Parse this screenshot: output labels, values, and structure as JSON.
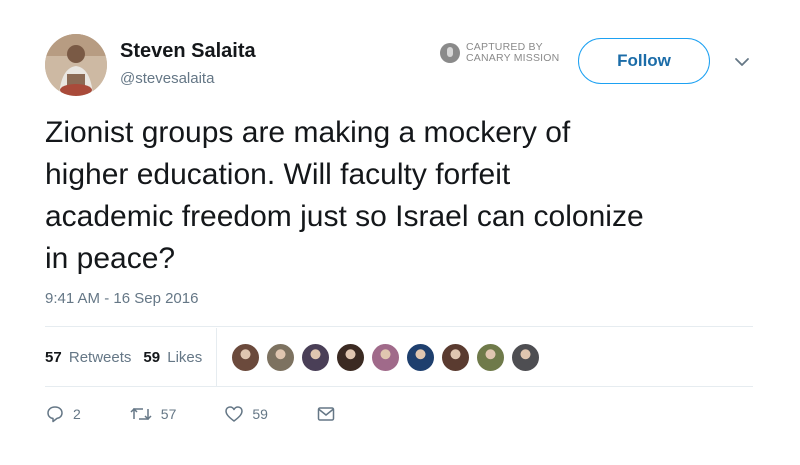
{
  "tweet": {
    "author": {
      "name": "Steven Salaita",
      "handle": "@stevesalaita"
    },
    "watermark": {
      "line1": "CAPTURED BY",
      "line2": "CANARY MISSION"
    },
    "follow_label": "Follow",
    "text": "Zionist groups are making a mockery of\nhigher education.  Will faculty forfeit\nacademic freedom just so Israel can colonize\nin peace?",
    "timestamp": "9:41 AM - 16 Sep 2016",
    "retweets": {
      "count": "57",
      "label": "Retweets"
    },
    "likes": {
      "count": "59",
      "label": "Likes"
    },
    "liker_faces": [
      {
        "color": "#6b4a3c"
      },
      {
        "color": "#7d7260"
      },
      {
        "color": "#4a3f57"
      },
      {
        "color": "#3b2a22"
      },
      {
        "color": "#a06a8a"
      },
      {
        "color": "#1e3f6e"
      },
      {
        "color": "#5a3b30"
      },
      {
        "color": "#6f7a4a"
      },
      {
        "color": "#4e4e52"
      }
    ],
    "actions": {
      "reply_count": "2",
      "retweet_count": "57",
      "like_count": "59"
    }
  },
  "colors": {
    "accent": "#1da1f2",
    "muted": "#657786",
    "text": "#14171a"
  }
}
